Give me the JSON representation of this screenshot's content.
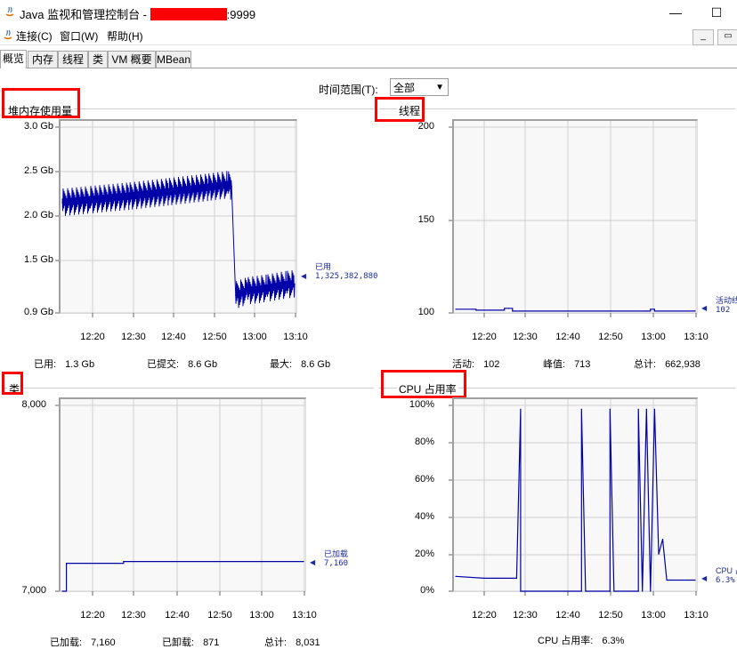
{
  "window": {
    "title_prefix": "Java 监视和管理控制台 - ",
    "title_suffix": ":9999",
    "minimize": "—",
    "maximize": "☐"
  },
  "menu": {
    "items": [
      "连接(C)",
      "窗口(W)",
      "帮助(H)"
    ],
    "inner_minimize": "_",
    "inner_restore": "▭"
  },
  "tabs": [
    "概览",
    "内存",
    "线程",
    "类",
    "VM 概要",
    "MBean"
  ],
  "time_range": {
    "label": "时间范围(T):",
    "value": "全部"
  },
  "colors": {
    "series": "#0000a8",
    "highlight": "#ff0000"
  },
  "panels": {
    "heap": {
      "title": "堆内存使用量",
      "y_ticks": [
        "3.0 Gb",
        "2.5 Gb",
        "2.0 Gb",
        "1.5 Gb",
        "0.9 Gb"
      ],
      "x_ticks": [
        "12:20",
        "12:30",
        "12:40",
        "12:50",
        "13:00",
        "13:10"
      ],
      "legend_name": "已用",
      "legend_value": "1,325,382,880",
      "stats": [
        {
          "label": "已用:",
          "value": "1.3 Gb"
        },
        {
          "label": "已提交:",
          "value": "8.6 Gb"
        },
        {
          "label": "最大:",
          "value": "8.6 Gb"
        }
      ]
    },
    "threads": {
      "title": "线程",
      "y_ticks": [
        "200",
        "150",
        "100"
      ],
      "x_ticks": [
        "12:20",
        "12:30",
        "12:40",
        "12:50",
        "13:00",
        "13:10"
      ],
      "legend_name": "活动线",
      "legend_value": "102",
      "stats": [
        {
          "label": "活动:",
          "value": "102"
        },
        {
          "label": "峰值:",
          "value": "713"
        },
        {
          "label": "总计:",
          "value": "662,938"
        }
      ]
    },
    "classes": {
      "title": "类",
      "y_ticks": [
        "8,000",
        "7,000"
      ],
      "x_ticks": [
        "12:20",
        "12:30",
        "12:40",
        "12:50",
        "13:00",
        "13:10"
      ],
      "legend_name": "已加载",
      "legend_value": "7,160",
      "stats": [
        {
          "label": "已加载:",
          "value": "7,160"
        },
        {
          "label": "已卸载:",
          "value": "871"
        },
        {
          "label": "总计:",
          "value": "8,031"
        }
      ]
    },
    "cpu": {
      "title": "CPU 占用率",
      "y_ticks": [
        "100%",
        "80%",
        "60%",
        "40%",
        "20%",
        "0%"
      ],
      "x_ticks": [
        "12:20",
        "12:30",
        "12:40",
        "12:50",
        "13:00",
        "13:10"
      ],
      "legend_name": "CPU 占",
      "legend_value": "6.3%",
      "stats": [
        {
          "label": "CPU 占用率:",
          "value": "6.3%"
        }
      ]
    }
  },
  "chart_data": [
    {
      "type": "line",
      "title": "堆内存使用量",
      "ylim": [
        0.9,
        3.0
      ],
      "x_range": [
        "12:13",
        "13:12"
      ],
      "series": [
        {
          "name": "已用",
          "x": [
            "12:13",
            "12:20",
            "12:30",
            "12:40",
            "12:50",
            "12:55",
            "12:56",
            "12:57",
            "13:00",
            "13:05",
            "13:10",
            "13:12"
          ],
          "values": [
            2.15,
            2.18,
            2.22,
            2.27,
            2.32,
            2.35,
            2.33,
            1.1,
            1.15,
            1.18,
            1.22,
            1.23
          ]
        }
      ]
    },
    {
      "type": "line",
      "title": "线程",
      "ylim": [
        100,
        200
      ],
      "x_range": [
        "12:13",
        "13:12"
      ],
      "series": [
        {
          "name": "活动线",
          "x": [
            "12:13",
            "12:17",
            "12:18",
            "12:24",
            "12:25",
            "12:26",
            "12:27",
            "13:00",
            "13:01",
            "13:02",
            "13:12"
          ],
          "values": [
            102,
            102,
            101.5,
            101.5,
            102.5,
            102.5,
            101,
            101,
            102,
            101,
            101
          ]
        }
      ]
    },
    {
      "type": "line",
      "title": "类",
      "ylim": [
        7000,
        8000
      ],
      "x_range": [
        "12:13",
        "13:12"
      ],
      "series": [
        {
          "name": "已加载",
          "x": [
            "12:13",
            "12:14",
            "12:27",
            "12:28",
            "13:12"
          ],
          "values": [
            7000,
            7150,
            7150,
            7160,
            7160
          ]
        }
      ]
    },
    {
      "type": "line",
      "title": "CPU 占用率",
      "ylim": [
        0,
        100
      ],
      "x_range": [
        "12:13",
        "13:12"
      ],
      "series": [
        {
          "name": "CPU 占",
          "x": [
            "12:13",
            "12:20",
            "12:28",
            "12:29",
            "12:29",
            "12:30",
            "12:44",
            "12:44",
            "12:45",
            "12:51",
            "12:51",
            "12:52",
            "12:58",
            "12:58",
            "12:59",
            "13:00",
            "13:01",
            "13:02",
            "13:03",
            "13:04",
            "13:05",
            "13:06",
            "13:12"
          ],
          "values": [
            8,
            7,
            7,
            98,
            0,
            0,
            0,
            98,
            0,
            0,
            98,
            0,
            0,
            98,
            0,
            98,
            0,
            98,
            20,
            28,
            6,
            6,
            6
          ]
        }
      ]
    }
  ]
}
